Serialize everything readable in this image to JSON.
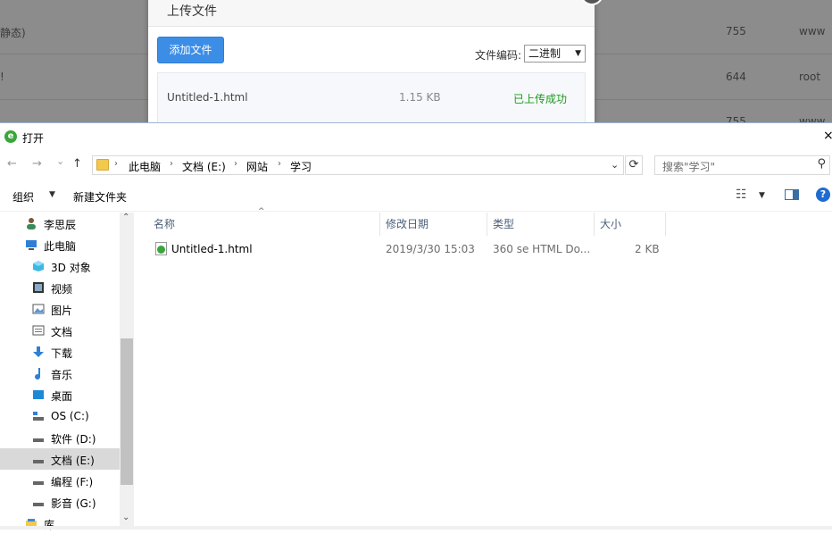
{
  "background": {
    "rows": [
      {
        "name": "静态)",
        "perm": "755",
        "owner": "www"
      },
      {
        "name": "!",
        "perm": "644",
        "owner": "root"
      },
      {
        "name": "",
        "perm": "755",
        "owner": "www"
      }
    ]
  },
  "upload_dialog": {
    "title": "上传文件",
    "add_button": "添加文件",
    "encoding_label": "文件编码:",
    "encoding_value": "二进制",
    "file": {
      "name": "Untitled-1.html",
      "size": "1.15 KB",
      "status": "已上传成功"
    }
  },
  "open_dialog": {
    "title": "打开",
    "app_icon_glyph": "e",
    "close_glyph": "×",
    "nav": {
      "back": "←",
      "forward": "→",
      "recent": "⌄",
      "up": "↑"
    },
    "breadcrumb": [
      "此电脑",
      "文档 (E:)",
      "网站",
      "学习"
    ],
    "search_placeholder": "搜索\"学习\"",
    "toolbar": {
      "organize": "组织",
      "new_folder": "新建文件夹",
      "help_glyph": "?"
    },
    "sidebar": [
      {
        "label": "李思辰",
        "icon": "user-icon",
        "selected": false
      },
      {
        "label": "此电脑",
        "icon": "computer-icon",
        "selected": false
      },
      {
        "label": "3D 对象",
        "icon": "cube-icon",
        "selected": false
      },
      {
        "label": "视频",
        "icon": "video-icon",
        "selected": false
      },
      {
        "label": "图片",
        "icon": "picture-icon",
        "selected": false
      },
      {
        "label": "文档",
        "icon": "document-icon",
        "selected": false
      },
      {
        "label": "下载",
        "icon": "download-icon",
        "selected": false
      },
      {
        "label": "音乐",
        "icon": "music-icon",
        "selected": false
      },
      {
        "label": "桌面",
        "icon": "desktop-icon",
        "selected": false
      },
      {
        "label": "OS (C:)",
        "icon": "os-drive-icon",
        "selected": false
      },
      {
        "label": "软件 (D:)",
        "icon": "drive-icon",
        "selected": false
      },
      {
        "label": "文档 (E:)",
        "icon": "drive-icon",
        "selected": true
      },
      {
        "label": "编程 (F:)",
        "icon": "drive-icon",
        "selected": false
      },
      {
        "label": "影音 (G:)",
        "icon": "drive-icon",
        "selected": false
      },
      {
        "label": "库",
        "icon": "library-icon",
        "selected": false
      }
    ],
    "columns": [
      "名称",
      "修改日期",
      "类型",
      "大小"
    ],
    "files": [
      {
        "name": "Untitled-1.html",
        "modified": "2019/3/30 15:03",
        "type": "360 se HTML Do...",
        "size": "2 KB"
      }
    ]
  },
  "colors": {
    "accent": "#3c8de6",
    "success": "#1a9b1a",
    "selected": "#d9d9d9"
  }
}
